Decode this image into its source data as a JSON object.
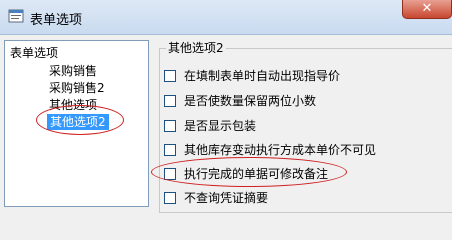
{
  "window": {
    "title": "表单选项",
    "close_glyph": "✕"
  },
  "tree": {
    "root": "表单选项",
    "children": [
      "采购销售",
      "采购销售2",
      "其他选项",
      "其他选项2"
    ],
    "selected": "其他选项2"
  },
  "group": {
    "title": "其他选项2",
    "options": [
      {
        "label": "在填制表单时自动出现指导价",
        "checked": false
      },
      {
        "label": "是否使数量保留两位小数",
        "checked": false
      },
      {
        "label": "是否显示包装",
        "checked": false
      },
      {
        "label": "其他库存变动执行方成本单价不可见",
        "checked": false
      },
      {
        "label": "执行完成的单据可修改备注",
        "checked": false
      },
      {
        "label": "不查询凭证摘要",
        "checked": false
      }
    ]
  },
  "colors": {
    "highlight": "#3399ff",
    "annotation": "#d02020"
  }
}
